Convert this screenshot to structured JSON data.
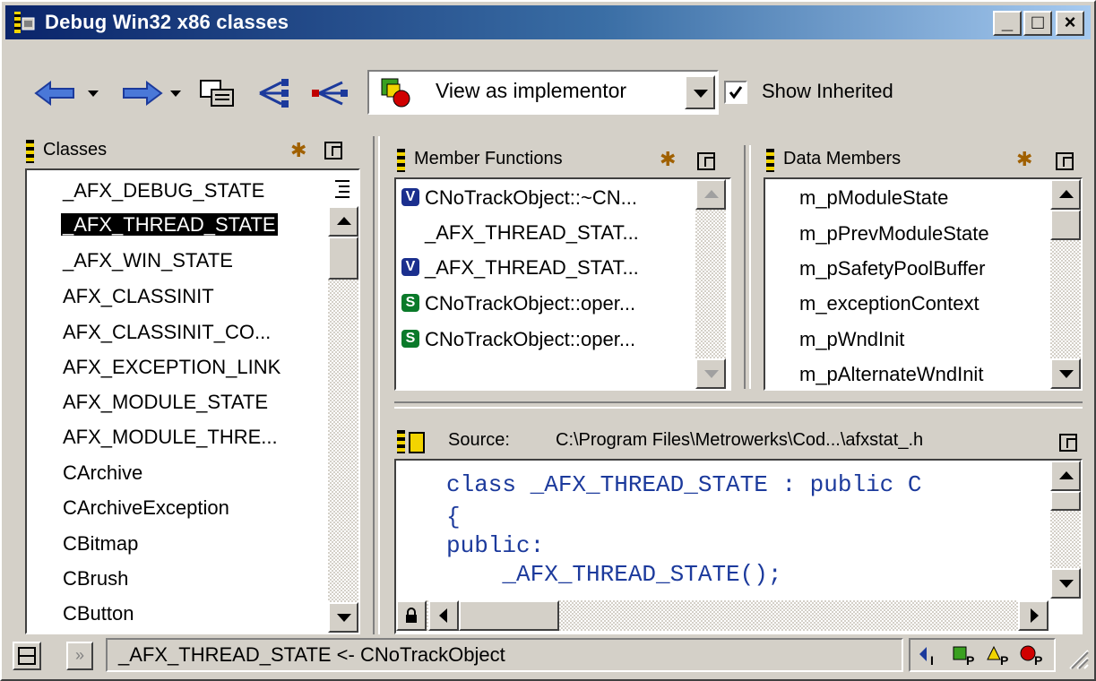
{
  "window": {
    "title": "Debug Win32 x86 classes"
  },
  "titlebar_buttons": {
    "minimize": "_",
    "maximize": "□",
    "close": "×"
  },
  "toolbar": {
    "view_mode": "View as implementor",
    "show_inherited_label": "Show Inherited",
    "show_inherited_checked": true
  },
  "classes": {
    "header": "Classes",
    "items": [
      "_AFX_DEBUG_STATE",
      "_AFX_THREAD_STATE",
      "_AFX_WIN_STATE",
      "AFX_CLASSINIT",
      "AFX_CLASSINIT_CO...",
      "AFX_EXCEPTION_LINK",
      "AFX_MODULE_STATE",
      "AFX_MODULE_THRE...",
      "CArchive",
      "CArchiveException",
      "CBitmap",
      "CBrush",
      "CButton"
    ],
    "selected_index": 1
  },
  "member_functions": {
    "header": "Member Functions",
    "items": [
      {
        "badge": "V",
        "name": "CNoTrackObject::~CN..."
      },
      {
        "badge": "",
        "name": "_AFX_THREAD_STAT..."
      },
      {
        "badge": "V",
        "name": "_AFX_THREAD_STAT..."
      },
      {
        "badge": "S",
        "name": "CNoTrackObject::oper..."
      },
      {
        "badge": "S",
        "name": "CNoTrackObject::oper..."
      }
    ]
  },
  "data_members": {
    "header": "Data Members",
    "items": [
      "m_pModuleState",
      "m_pPrevModuleState",
      "m_pSafetyPoolBuffer",
      "m_exceptionContext",
      "m_pWndInit",
      "m_pAlternateWndInit"
    ]
  },
  "source": {
    "label": "Source:",
    "path": "C:\\Program Files\\Metrowerks\\Cod...\\afxstat_.h",
    "lines": [
      "class _AFX_THREAD_STATE : public C",
      "{",
      "public:",
      "    _AFX_THREAD_STATE();"
    ]
  },
  "status": {
    "text": "_AFX_THREAD_STATE <- CNoTrackObject",
    "filter_icons": [
      "I",
      "P",
      "P",
      "P"
    ]
  },
  "colors": {
    "title_start": "#0a246a",
    "title_end": "#a6caf0",
    "selection": "#000000",
    "code_blue": "#1c3a9c",
    "badge_virtual": "#1b2f8e",
    "badge_static": "#0a7a2a"
  }
}
